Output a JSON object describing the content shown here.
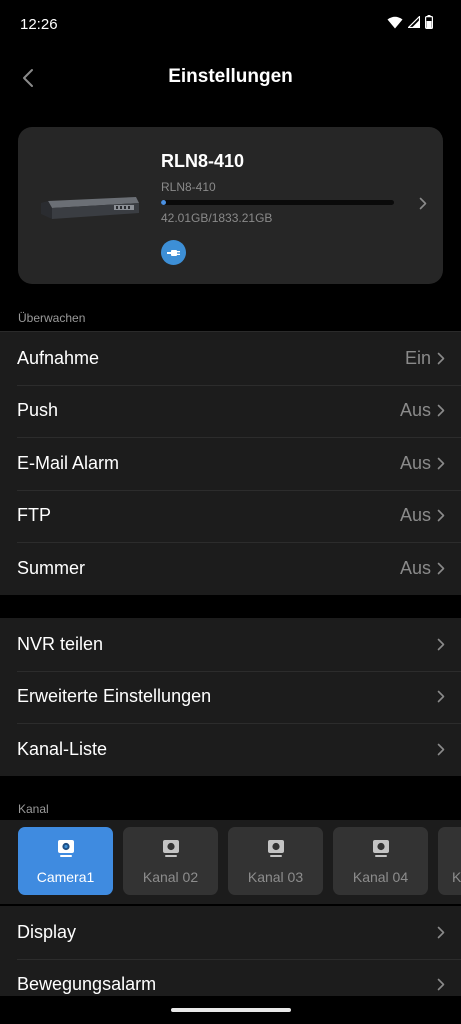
{
  "status_bar": {
    "time": "12:26"
  },
  "header": {
    "title": "Einstellungen"
  },
  "device": {
    "name": "RLN8-410",
    "model": "RLN8-410",
    "storage_text": "42.01GB/1833.21GB",
    "storage_used_fraction": 0.023
  },
  "monitoring": {
    "header": "Überwachen",
    "items": [
      {
        "label": "Aufnahme",
        "value": "Ein"
      },
      {
        "label": "Push",
        "value": "Aus"
      },
      {
        "label": "E-Mail Alarm",
        "value": "Aus"
      },
      {
        "label": "FTP",
        "value": "Aus"
      },
      {
        "label": "Summer",
        "value": "Aus"
      }
    ]
  },
  "general": {
    "items": [
      {
        "label": "NVR teilen"
      },
      {
        "label": "Erweiterte Einstellungen"
      },
      {
        "label": "Kanal-Liste"
      }
    ]
  },
  "channels": {
    "header": "Kanal",
    "tiles": [
      {
        "label": "Camera1",
        "active": true
      },
      {
        "label": "Kanal 02",
        "active": false
      },
      {
        "label": "Kanal 03",
        "active": false
      },
      {
        "label": "Kanal 04",
        "active": false
      },
      {
        "label": "K",
        "active": false
      }
    ]
  },
  "channel_settings": {
    "items": [
      {
        "label": "Display"
      },
      {
        "label": "Bewegungsalarm"
      }
    ]
  },
  "colors": {
    "accent": "#3f8be0",
    "background": "#000000",
    "card": "#262626",
    "row": "#1c1c1c"
  }
}
